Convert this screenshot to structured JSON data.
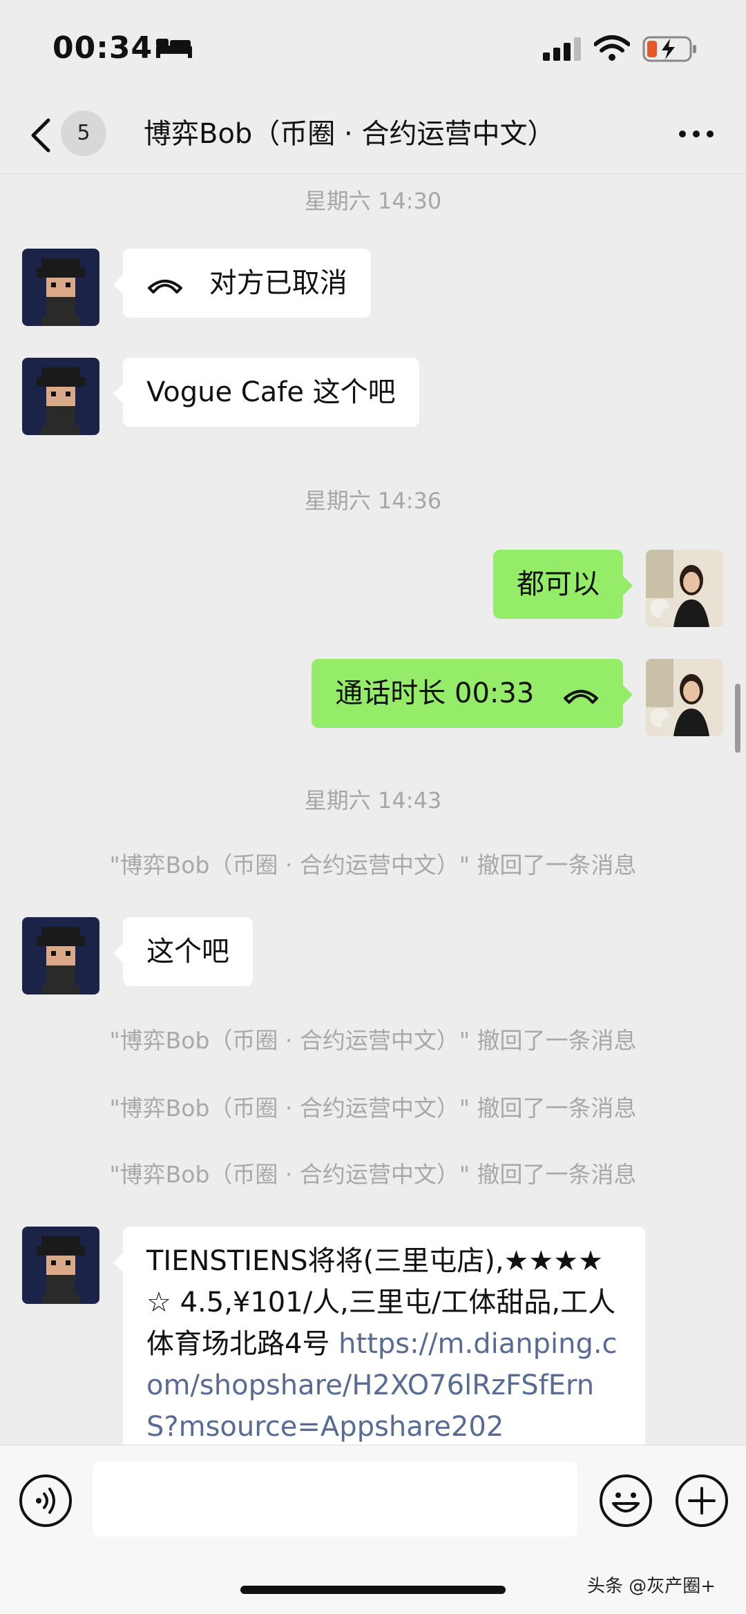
{
  "status_bar": {
    "time": "00:34"
  },
  "header": {
    "unread_count": "5",
    "title": "博弈Bob（币圈 · 合约运营中文）"
  },
  "messages": {
    "time1": "星期六 14:30",
    "call_cancelled": "对方已取消",
    "msg_vogue": "Vogue Cafe 这个吧",
    "time2": "星期六 14:36",
    "msg_ok": "都可以",
    "call_duration": "通话时长 00:33",
    "time3": "星期六 14:43",
    "recall_1": "\"博弈Bob（币圈 · 合约运营中文）\" 撤回了一条消息",
    "msg_this": "这个吧",
    "recall_2": "\"博弈Bob（币圈 · 合约运营中文）\" 撤回了一条消息",
    "recall_3": "\"博弈Bob（币圈 · 合约运营中文）\" 撤回了一条消息",
    "recall_4": "\"博弈Bob（币圈 · 合约运营中文）\" 撤回了一条消息",
    "share_text": "TIENSTIENS将将(三里屯店),★★★★☆ 4.5,¥101/人,三里屯/工体甜品,工人体育场北路4号 ",
    "share_link": "https://m.dianping.com/shopshare/H2XO76lRzFSfErnS?msource=Appshare202"
  },
  "input": {
    "placeholder": ""
  },
  "watermark": "头条 @灰产圈+",
  "colors": {
    "outgoing_bubble": "#95ec69",
    "incoming_bubble": "#ffffff",
    "background": "#ededed",
    "link": "#576b95"
  }
}
